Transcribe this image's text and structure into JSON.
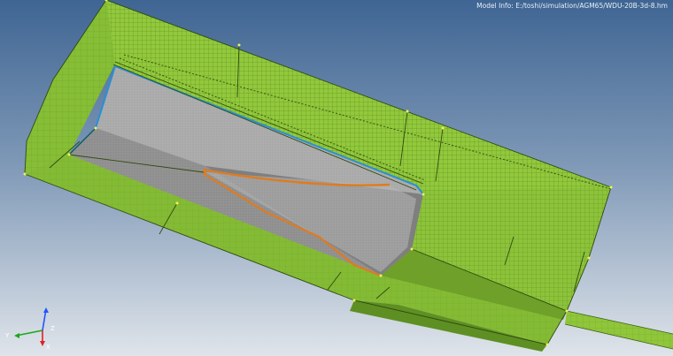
{
  "model_info": {
    "label": "Model Info:",
    "path": "E:/toshi/simulation/AGM65/WDU-20B-3d-8.hm"
  },
  "triad": {
    "x_label": "Y",
    "y_label": "X",
    "z_label": "Z"
  },
  "colors": {
    "background_top": "#4a6f9b",
    "background_bottom": "#d7dde6",
    "mesh_green": "#8fc63a",
    "mesh_green_dark": "#6fa42a",
    "interior_gray": "#9a9a9a",
    "edge_blue": "#2a8fd6",
    "edge_orange": "#e07b1f"
  }
}
